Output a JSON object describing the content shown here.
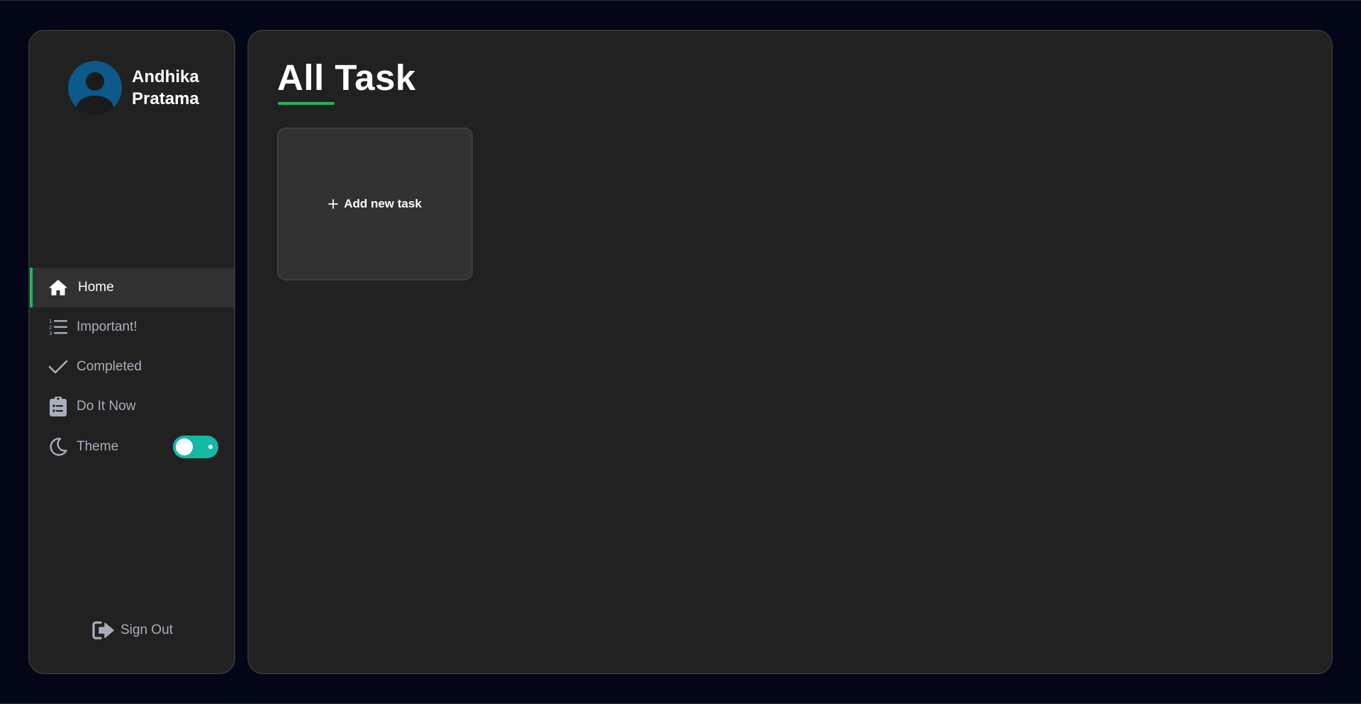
{
  "user": {
    "name": "Andhika Pratama",
    "avatar_icon": "user-avatar-icon"
  },
  "nav": {
    "items": [
      {
        "label": "Home",
        "icon": "home-icon",
        "active": true
      },
      {
        "label": "Important!",
        "icon": "numbered-list-icon",
        "active": false
      },
      {
        "label": "Completed",
        "icon": "checkmark-icon",
        "active": false
      },
      {
        "label": "Do It Now",
        "icon": "clipboard-list-icon",
        "active": false
      }
    ]
  },
  "theme": {
    "label": "Theme",
    "icon": "moon-icon",
    "toggle_on": true
  },
  "signout": {
    "label": "Sign Out",
    "icon": "sign-out-icon"
  },
  "main": {
    "title": "All Task",
    "add_task_label": "Add new task"
  },
  "colors": {
    "background": "#020617",
    "panel": "#212121",
    "accent_green": "#27ae60",
    "toggle_teal": "#14b8a6",
    "avatar_blue": "#0b5a8a"
  }
}
